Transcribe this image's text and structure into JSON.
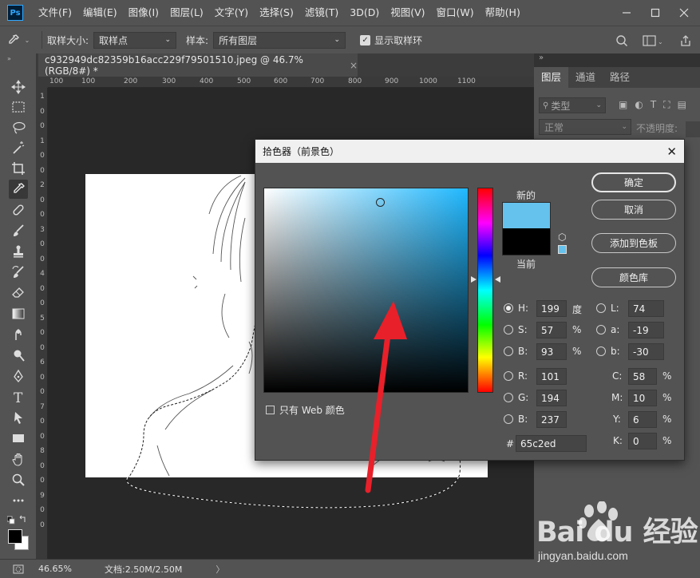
{
  "app": {
    "logo_text": "Ps"
  },
  "menu": [
    "文件(F)",
    "编辑(E)",
    "图像(I)",
    "图层(L)",
    "文字(Y)",
    "选择(S)",
    "滤镜(T)",
    "3D(D)",
    "视图(V)",
    "窗口(W)",
    "帮助(H)"
  ],
  "options_bar": {
    "sample_size_label": "取样大小:",
    "sample_size_value": "取样点",
    "sample_label": "样本:",
    "sample_value": "所有图层",
    "show_ring_label": "显示取样环",
    "show_ring_checked": true
  },
  "document_tab": {
    "title": "c932949dc82359b16acc229f79501510.jpeg @ 46.7%(RGB/8#) *",
    "close": "×"
  },
  "ruler_h_labels": [
    "100",
    "100",
    "200",
    "300",
    "400",
    "500",
    "600",
    "700",
    "800",
    "900",
    "1000",
    "1100"
  ],
  "ruler_v_labels": [
    "1",
    "0",
    "0",
    "1",
    "0",
    "0",
    "2",
    "0",
    "0",
    "3",
    "0",
    "0",
    "4",
    "0",
    "0",
    "5",
    "0",
    "0",
    "6",
    "0",
    "0",
    "7",
    "0",
    "0",
    "8",
    "0",
    "0",
    "9",
    "0",
    "0"
  ],
  "status_bar": {
    "zoom": "46.65%",
    "doc_info": "文档:2.50M/2.50M",
    "arrow": "〉"
  },
  "right_panel": {
    "tabs": [
      "图层",
      "通道",
      "路径"
    ],
    "active_tab": 0,
    "kind_filter": "类型",
    "blend_mode": "正常",
    "opacity_label": "不透明度:"
  },
  "color_picker": {
    "title": "拾色器（前景色）",
    "close": "✕",
    "new_label": "新的",
    "current_label": "当前",
    "new_color": "#65c2ed",
    "current_color": "#000000",
    "buttons": {
      "ok": "确定",
      "cancel": "取消",
      "add_to_swatches": "添加到色板",
      "color_libraries": "颜色库"
    },
    "fields": {
      "H": {
        "label": "H:",
        "value": "199",
        "unit": "度",
        "selected": true
      },
      "S": {
        "label": "S:",
        "value": "57",
        "unit": "%"
      },
      "B": {
        "label": "B:",
        "value": "93",
        "unit": "%"
      },
      "R": {
        "label": "R:",
        "value": "101"
      },
      "G": {
        "label": "G:",
        "value": "194"
      },
      "Bl": {
        "label": "B:",
        "value": "237"
      },
      "L": {
        "label": "L:",
        "value": "74"
      },
      "a": {
        "label": "a:",
        "value": "-19"
      },
      "b": {
        "label": "b:",
        "value": "-30"
      },
      "C": {
        "label": "C:",
        "value": "58",
        "unit": "%"
      },
      "M": {
        "label": "M:",
        "value": "10",
        "unit": "%"
      },
      "Y": {
        "label": "Y:",
        "value": "6",
        "unit": "%"
      },
      "K": {
        "label": "K:",
        "value": "0",
        "unit": "%"
      }
    },
    "hex_label": "#",
    "hex_value": "65c2ed",
    "web_only_label": "只有 Web 颜色",
    "hue_field_color": "#20b8ff",
    "marker_saturation": 0.57,
    "marker_brightness": 0.93,
    "hue_degrees": 199
  },
  "annotation": {
    "arrow_color": "#e8202a"
  },
  "watermark": {
    "logo": "Bai du 经验",
    "url": "jingyan.baidu.com"
  }
}
